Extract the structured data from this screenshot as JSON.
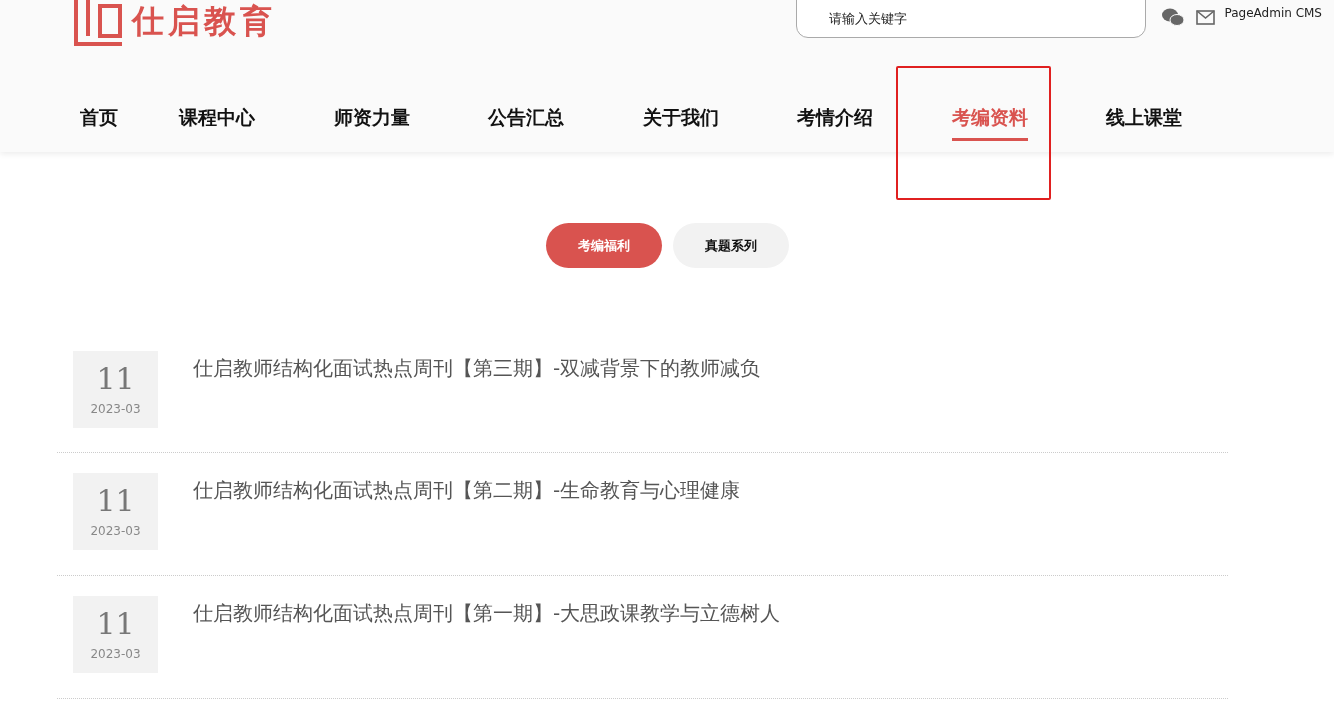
{
  "header": {
    "logo_text": "仕启教育",
    "search": {
      "placeholder": "请输入关键字"
    },
    "brand_link": "PageAdmin CMS"
  },
  "nav": [
    {
      "label": "首页",
      "selected": false,
      "highlighted": false
    },
    {
      "label": "课程中心",
      "selected": false,
      "highlighted": false
    },
    {
      "label": "师资力量",
      "selected": false,
      "highlighted": false
    },
    {
      "label": "公告汇总",
      "selected": false,
      "highlighted": false
    },
    {
      "label": "关于我们",
      "selected": false,
      "highlighted": false
    },
    {
      "label": "考情介绍",
      "selected": false,
      "highlighted": false
    },
    {
      "label": "考编资料",
      "selected": true,
      "highlighted": true
    },
    {
      "label": "线上课堂",
      "selected": false,
      "highlighted": false
    }
  ],
  "tabs": [
    {
      "label": "考编福利",
      "selected": true
    },
    {
      "label": "真题系列",
      "selected": false
    }
  ],
  "articles": [
    {
      "day": "11",
      "month": "2023-03",
      "title": "仕启教师结构化面试热点周刊【第三期】-双减背景下的教师减负"
    },
    {
      "day": "11",
      "month": "2023-03",
      "title": "仕启教师结构化面试热点周刊【第二期】-生命教育与心理健康"
    },
    {
      "day": "11",
      "month": "2023-03",
      "title": "仕启教师结构化面试热点周刊【第一期】-大思政课教学与立德树人"
    }
  ]
}
